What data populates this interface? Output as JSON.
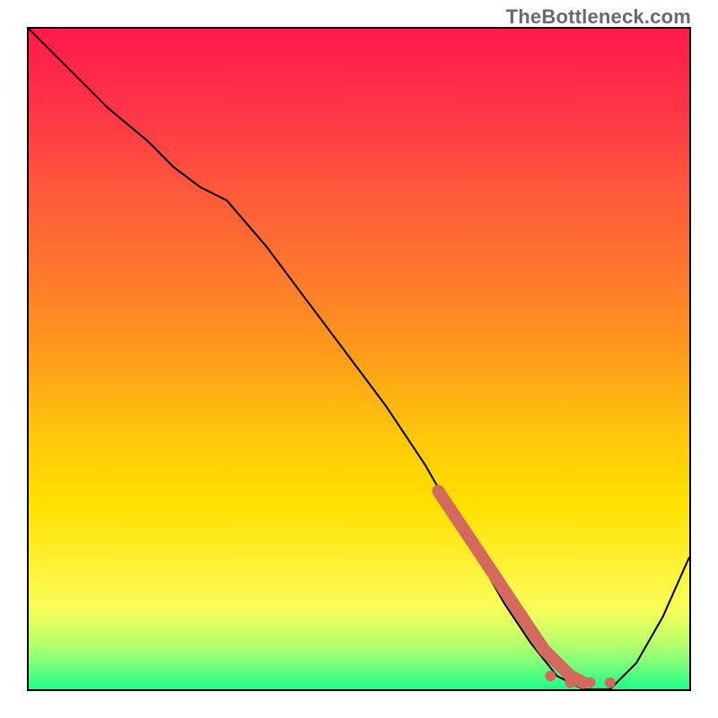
{
  "watermark": "TheBottleneck.com",
  "colors": {
    "gradient_stops": [
      {
        "offset": 0.0,
        "color": "#ff1a4d"
      },
      {
        "offset": 0.12,
        "color": "#ff3348"
      },
      {
        "offset": 0.25,
        "color": "#ff5a3a"
      },
      {
        "offset": 0.38,
        "color": "#ff7a2c"
      },
      {
        "offset": 0.5,
        "color": "#ff9e1a"
      },
      {
        "offset": 0.62,
        "color": "#ffc80a"
      },
      {
        "offset": 0.72,
        "color": "#ffe000"
      },
      {
        "offset": 0.82,
        "color": "#fff23a"
      },
      {
        "offset": 0.88,
        "color": "#f6ff5a"
      },
      {
        "offset": 0.92,
        "color": "#c8ff66"
      },
      {
        "offset": 0.96,
        "color": "#80ff7a"
      },
      {
        "offset": 1.0,
        "color": "#1aff88"
      }
    ],
    "curve": "#000000",
    "markers": "#d46a5e"
  },
  "chart_data": {
    "type": "line",
    "title": "",
    "xlabel": "",
    "ylabel": "",
    "xlim": [
      0,
      100
    ],
    "ylim": [
      0,
      100
    ],
    "grid": false,
    "legend": false,
    "series": [
      {
        "name": "bottleneck-curve",
        "x": [
          0,
          6,
          12,
          18,
          22,
          26,
          30,
          36,
          42,
          48,
          54,
          60,
          64,
          68,
          72,
          76,
          80,
          84,
          88,
          92,
          96,
          100
        ],
        "y": [
          100,
          94,
          88,
          83,
          79,
          76,
          74,
          67,
          59,
          51,
          43,
          34,
          27,
          20,
          13,
          7,
          2,
          0,
          0,
          4,
          11,
          20
        ]
      }
    ],
    "markers": {
      "name": "highlight-segment",
      "x": [
        62,
        64,
        66,
        68,
        70,
        72,
        74,
        76,
        78,
        80,
        82,
        84
      ],
      "y": [
        30,
        27,
        24,
        21,
        18,
        15,
        12,
        9,
        6,
        4,
        2,
        1
      ]
    },
    "dots": {
      "name": "baseline-dots",
      "x": [
        79,
        82,
        85,
        88
      ],
      "y": [
        2,
        1,
        1,
        1
      ]
    }
  }
}
